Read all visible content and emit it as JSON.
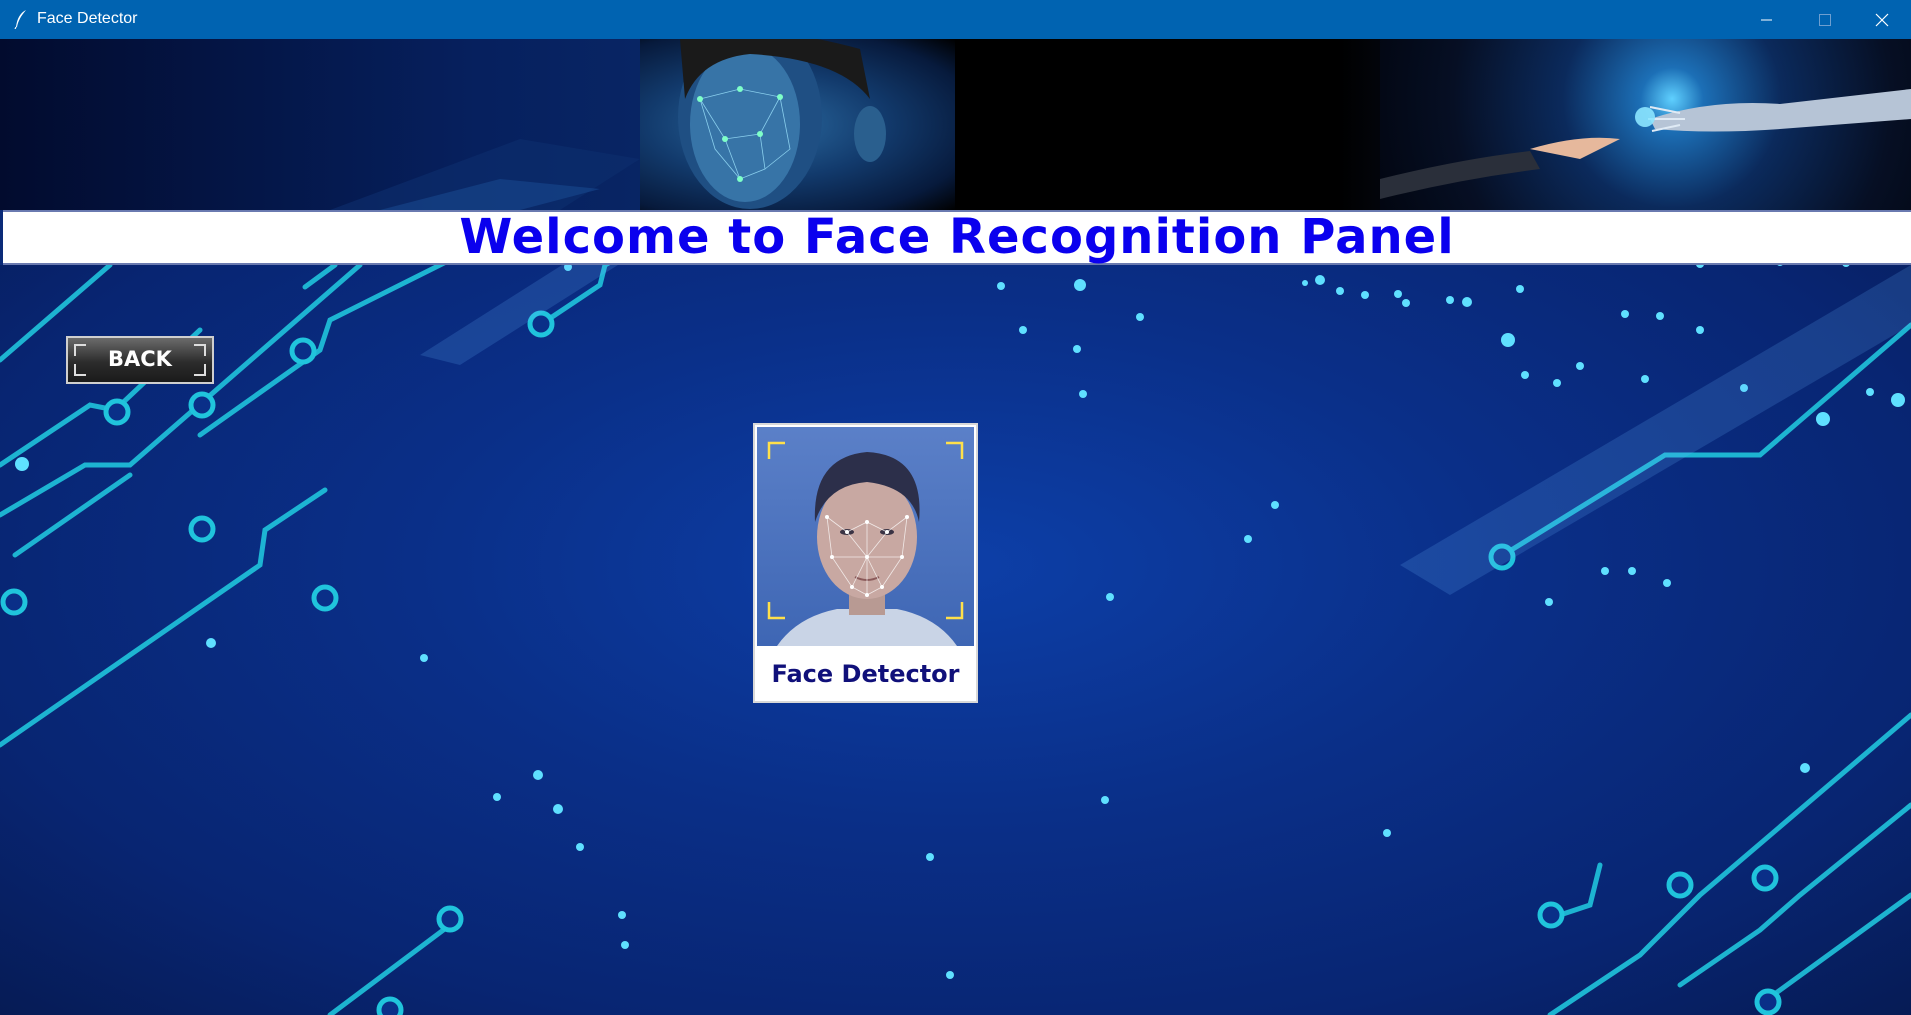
{
  "window": {
    "title": "Face Detector",
    "controls": [
      "minimize",
      "maximize",
      "close"
    ]
  },
  "heading": {
    "title": "Welcome to Face Recognition Panel"
  },
  "nav": {
    "back_label": "BACK"
  },
  "cards": [
    {
      "label": "Face Detector",
      "image": "face-scan-portrait"
    }
  ],
  "theme": {
    "titlebar": "#0063b1",
    "heading_color": "#0a00ee",
    "background": "#0a2f88",
    "circuit": "#22c8e0"
  }
}
